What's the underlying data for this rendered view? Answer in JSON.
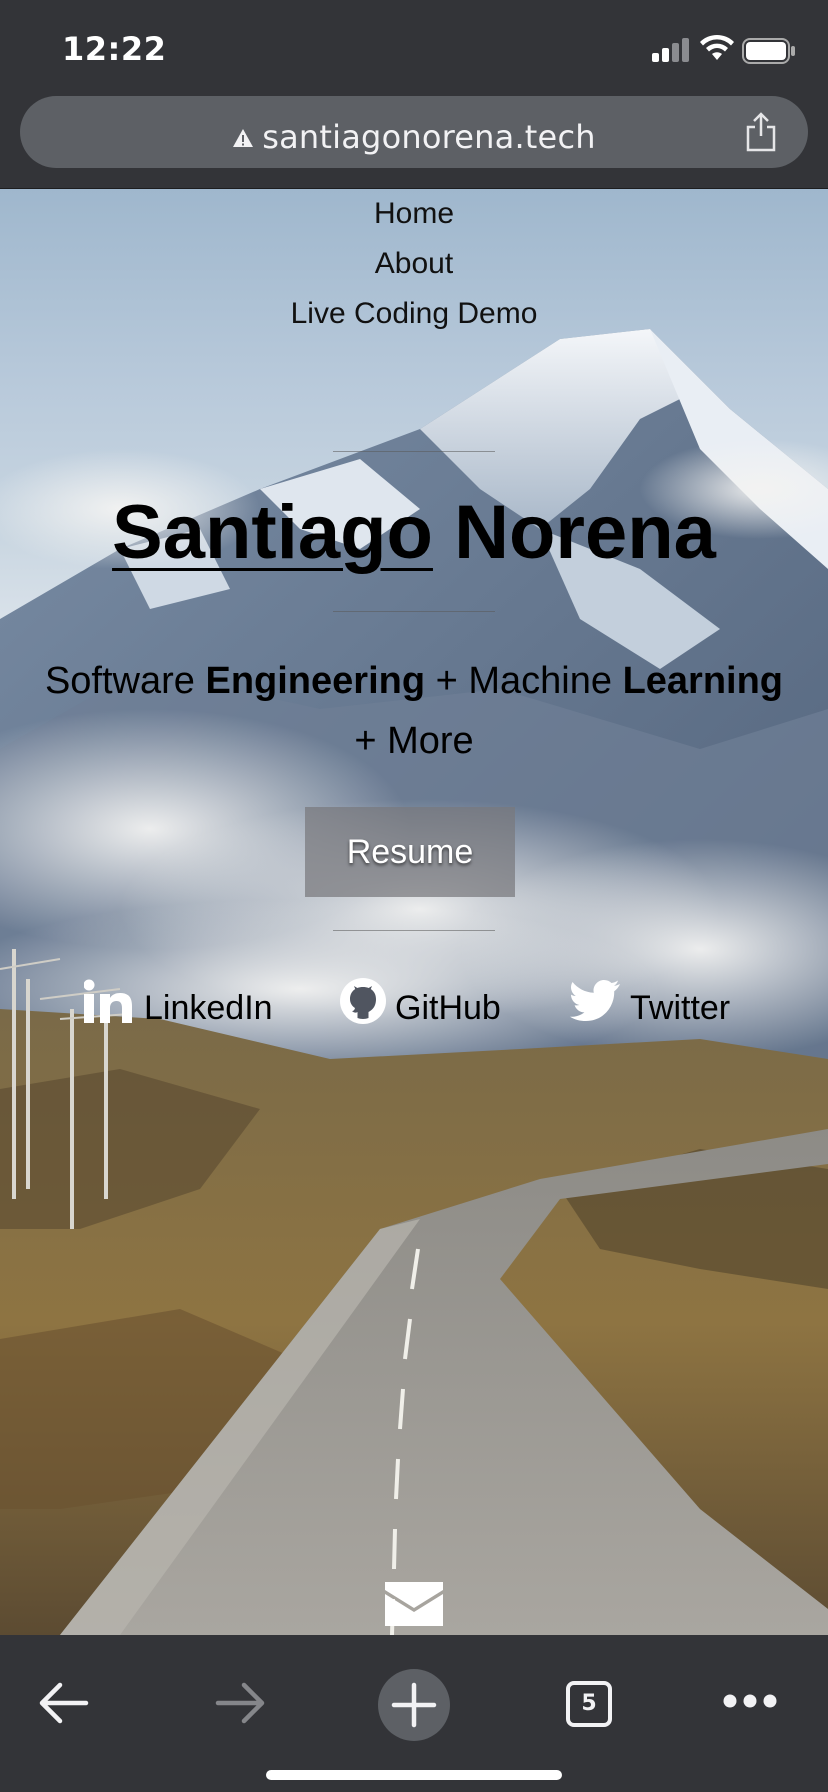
{
  "status_bar": {
    "time": "12:22"
  },
  "browser": {
    "url": "santiagonorena.tech",
    "tab_count": "5"
  },
  "nav": {
    "items": [
      "Home",
      "About",
      "Live Coding Demo"
    ]
  },
  "hero": {
    "first_name": "Santiago",
    "last_name": "Norena",
    "tagline_parts": [
      "Software ",
      "Engineering",
      " + Machine ",
      "Learning",
      " + More"
    ],
    "resume_label": "Resume"
  },
  "social": [
    {
      "label": "LinkedIn",
      "icon": "linkedin-icon"
    },
    {
      "label": "GitHub",
      "icon": "github-icon"
    },
    {
      "label": "Twitter",
      "icon": "twitter-icon"
    }
  ],
  "colors": {
    "chrome_bg": "#333438",
    "urlbar_bg": "#5d6065",
    "text": "#000000"
  }
}
